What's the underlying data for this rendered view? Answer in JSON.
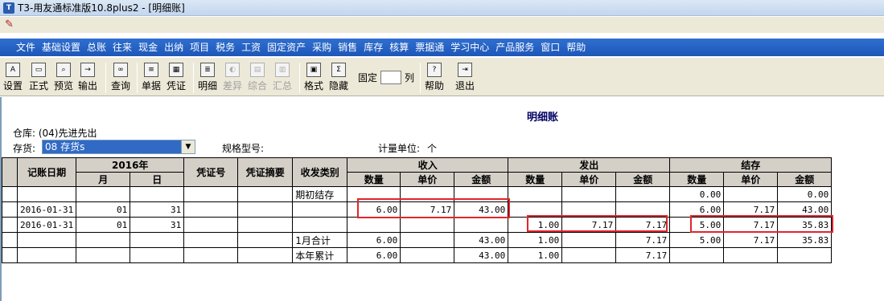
{
  "title": "T3-用友通标准版10.8plus2 - [明细账]",
  "menu": [
    "文件",
    "基础设置",
    "总账",
    "往来",
    "现金",
    "出纳",
    "项目",
    "税务",
    "工资",
    "固定资产",
    "采购",
    "销售",
    "库存",
    "核算",
    "票据通",
    "学习中心",
    "产品服务",
    "窗口",
    "帮助"
  ],
  "toolbar": {
    "setup": "设置",
    "formal": "正式",
    "preview": "预览",
    "export": "输出",
    "query": "查询",
    "document": "单据",
    "voucher": "凭证",
    "detail": "明细",
    "diff": "差异",
    "summary": "综合",
    "total": "汇总",
    "format": "格式",
    "hide": "隐藏",
    "fix_prefix": "固定",
    "fix_suffix": "列",
    "help": "帮助",
    "exit": "退出"
  },
  "report": {
    "title": "明细账",
    "warehouse": "仓库: (04)先进先出",
    "inventory_label": "存货:",
    "inventory_value": "08 存货s",
    "spec_label": "规格型号:",
    "unit_label": "计量单位:",
    "unit_value": "个"
  },
  "table": {
    "headers": {
      "date": "记账日期",
      "year": "2016年",
      "month": "月",
      "day": "日",
      "voucher_no": "凭证号",
      "voucher_desc": "凭证摘要",
      "category": "收发类别",
      "in": "收入",
      "out": "发出",
      "balance": "结存",
      "qty": "数量",
      "price": "单价",
      "amount": "金额"
    },
    "rows": [
      {
        "date": "",
        "month": "",
        "day": "",
        "vno": "",
        "vdesc": "",
        "cat": "期初结存",
        "in_qty": "",
        "in_price": "",
        "in_amt": "",
        "out_qty": "",
        "out_price": "",
        "out_amt": "",
        "bal_qty": "0.00",
        "bal_price": "",
        "bal_amt": "0.00"
      },
      {
        "date": "2016-01-31",
        "month": "01",
        "day": "31",
        "vno": "",
        "vdesc": "",
        "cat": "",
        "in_qty": "6.00",
        "in_price": "7.17",
        "in_amt": "43.00",
        "out_qty": "",
        "out_price": "",
        "out_amt": "",
        "bal_qty": "6.00",
        "bal_price": "7.17",
        "bal_amt": "43.00"
      },
      {
        "date": "2016-01-31",
        "month": "01",
        "day": "31",
        "vno": "",
        "vdesc": "",
        "cat": "",
        "in_qty": "",
        "in_price": "",
        "in_amt": "",
        "out_qty": "1.00",
        "out_price": "7.17",
        "out_amt": "7.17",
        "bal_qty": "5.00",
        "bal_price": "7.17",
        "bal_amt": "35.83"
      },
      {
        "date": "",
        "month": "",
        "day": "",
        "vno": "",
        "vdesc": "",
        "cat": "1月合计",
        "in_qty": "6.00",
        "in_price": "",
        "in_amt": "43.00",
        "out_qty": "1.00",
        "out_price": "",
        "out_amt": "7.17",
        "bal_qty": "5.00",
        "bal_price": "7.17",
        "bal_amt": "35.83"
      },
      {
        "date": "",
        "month": "",
        "day": "",
        "vno": "",
        "vdesc": "",
        "cat": "本年累计",
        "in_qty": "6.00",
        "in_price": "",
        "in_amt": "43.00",
        "out_qty": "1.00",
        "out_price": "",
        "out_amt": "7.17",
        "bal_qty": "",
        "bal_price": "",
        "bal_amt": ""
      }
    ]
  },
  "colors": {
    "highlight": "#e0262c",
    "menubar": "#2f6fd0",
    "selection": "#316ac5"
  }
}
